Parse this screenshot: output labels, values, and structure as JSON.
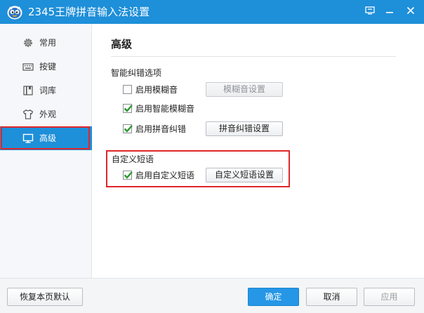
{
  "window": {
    "title": "2345王牌拼音输入法设置",
    "accent_color": "#1e8fd9",
    "controls": {
      "menu_icon": "menu-icon",
      "minimize_icon": "minimize-icon",
      "close_icon": "close-icon"
    }
  },
  "sidebar": {
    "items": [
      {
        "label": "常用",
        "icon": "gear-icon"
      },
      {
        "label": "按键",
        "icon": "keyboard-icon"
      },
      {
        "label": "词库",
        "icon": "book-icon"
      },
      {
        "label": "外观",
        "icon": "shirt-icon"
      },
      {
        "label": "高级",
        "icon": "monitor-icon",
        "active": true
      }
    ]
  },
  "main": {
    "title": "高级",
    "fuzzy_group": {
      "title": "智能纠错选项",
      "options": [
        {
          "label": "启用模糊音",
          "checked": false,
          "button": "模糊音设置",
          "button_enabled": false
        },
        {
          "label": "启用智能模糊音",
          "checked": true
        },
        {
          "label": "启用拼音纠错",
          "checked": true,
          "button": "拼音纠错设置",
          "button_enabled": true
        }
      ]
    },
    "custom_group": {
      "title": "自定义短语",
      "option": {
        "label": "启用自定义短语",
        "checked": true
      },
      "button": "自定义短语设置"
    }
  },
  "footer": {
    "reset": "恢复本页默认",
    "ok": "确定",
    "cancel": "取消",
    "apply": "应用"
  },
  "colors": {
    "highlight_red": "#e0262a",
    "check_green": "#2a9a2a",
    "primary_button": "#2597e6"
  }
}
